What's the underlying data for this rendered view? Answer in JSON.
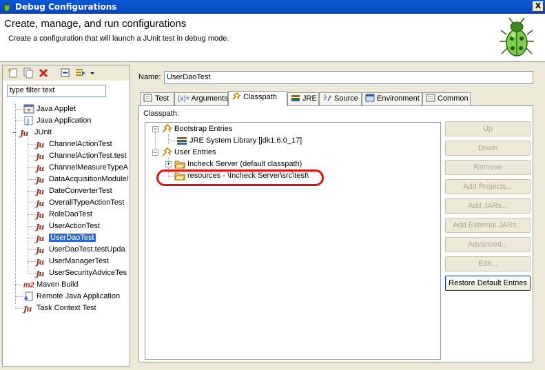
{
  "window": {
    "title": "Debug Configurations",
    "close_label": "X"
  },
  "header": {
    "title": "Create, manage, and run configurations",
    "subtitle": "Create a configuration that will launch a JUnit test in debug mode."
  },
  "left": {
    "filter_placeholder": "type filter text",
    "tree": [
      {
        "label": "Java Applet",
        "icon": "java-applet-icon"
      },
      {
        "label": "Java Application",
        "icon": "java-application-icon"
      },
      {
        "label": "JUnit",
        "icon": "junit-icon",
        "expanded": true
      },
      {
        "label": "ChannelActionTest",
        "icon": "junit-icon"
      },
      {
        "label": "ChannelActionTest.test",
        "icon": "junit-icon"
      },
      {
        "label": "ChannelMeasureTypeA",
        "icon": "junit-icon"
      },
      {
        "label": "DataAcquisitionModule/",
        "icon": "junit-icon"
      },
      {
        "label": "DateConverterTest",
        "icon": "junit-icon"
      },
      {
        "label": "OverallTypeActionTest",
        "icon": "junit-icon"
      },
      {
        "label": "RoleDaoTest",
        "icon": "junit-icon"
      },
      {
        "label": "UserActionTest",
        "icon": "junit-icon"
      },
      {
        "label": "UserDaoTest",
        "icon": "junit-icon",
        "selected": true
      },
      {
        "label": "UserDaoTest.testUpda",
        "icon": "junit-icon"
      },
      {
        "label": "UserManagerTest",
        "icon": "junit-icon"
      },
      {
        "label": "UserSecurityAdviceTes",
        "icon": "junit-icon"
      },
      {
        "label": "Maven Build",
        "icon": "maven-m2-icon"
      },
      {
        "label": "Remote Java Application",
        "icon": "remote-java-icon"
      },
      {
        "label": "Task Context Test",
        "icon": "task-context-icon"
      }
    ]
  },
  "config": {
    "name_label": "Name:",
    "name_value": "UserDaoTest",
    "tabs": [
      {
        "label": "Test",
        "icon": "test-tab-icon"
      },
      {
        "label": "Arguments",
        "icon": "arguments-icon",
        "prefix": "(x)="
      },
      {
        "label": "Classpath",
        "icon": "classpath-icon",
        "active": true
      },
      {
        "label": "JRE",
        "icon": "jre-icon"
      },
      {
        "label": "Source",
        "icon": "source-icon"
      },
      {
        "label": "Environment",
        "icon": "environment-icon"
      },
      {
        "label": "Common",
        "icon": "common-icon"
      }
    ],
    "classpath_label": "Classpath:",
    "classpath": {
      "bootstrap": "Bootstrap Entries",
      "jre": "JRE System Library [jdk1.6.0_17]",
      "user": "User Entries",
      "incheck": "Incheck Server (default classpath)",
      "resources": "resources - \\Incheck Server\\src\\test\\"
    },
    "buttons": [
      {
        "label": "Up",
        "enabled": false
      },
      {
        "label": "Down",
        "enabled": false
      },
      {
        "label": "Remove",
        "enabled": false
      },
      {
        "label": "Add Projects...",
        "enabled": false
      },
      {
        "label": "Add JARs...",
        "enabled": false
      },
      {
        "label": "Add External JARs...",
        "enabled": false
      },
      {
        "label": "Advanced...",
        "enabled": false
      },
      {
        "label": "Edit...",
        "enabled": false
      },
      {
        "label": "Restore Default Entries",
        "enabled": true
      }
    ]
  },
  "colors": {
    "titlebar": "#0a58d6",
    "selection": "#316ac5",
    "annotation": "#e01010"
  }
}
